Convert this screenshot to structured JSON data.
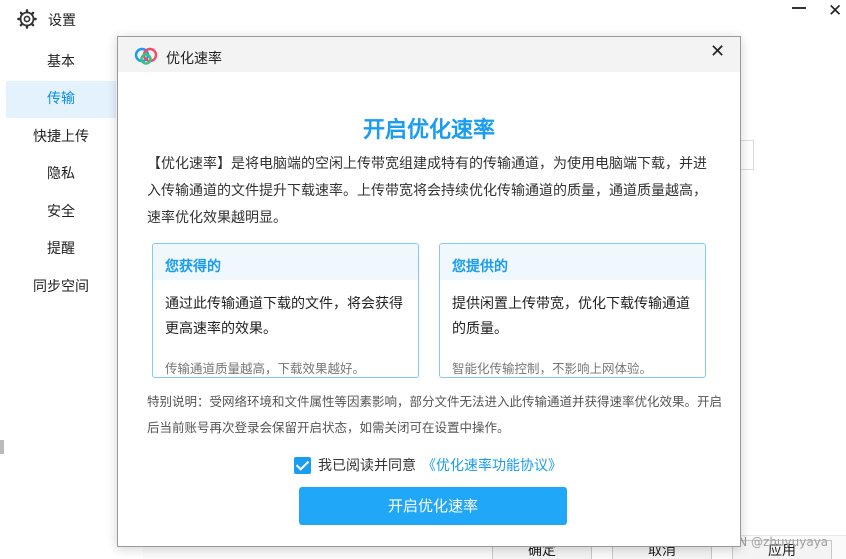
{
  "settings": {
    "title": "设置",
    "gear_icon": "gear-icon",
    "sidebar": {
      "items": [
        {
          "label": "基本",
          "active": false
        },
        {
          "label": "传输",
          "active": true
        },
        {
          "label": "快捷上传",
          "active": false
        },
        {
          "label": "隐私",
          "active": false
        },
        {
          "label": "安全",
          "active": false
        },
        {
          "label": "提醒",
          "active": false
        },
        {
          "label": "同步空间",
          "active": false
        }
      ]
    },
    "footer": {
      "ok_label": "确定",
      "cancel_label": "取消",
      "apply_label": "应用"
    }
  },
  "modal": {
    "title": "优化速率",
    "heading": "开启优化速率",
    "description": "【优化速率】是将电脑端的空闲上传带宽组建成特有的传输通道，为使用电脑端下载，并进入传输通道的文件提升下载速率。上传带宽将会持续优化传输通道的质量，通道质量越高，速率优化效果越明显。",
    "cards": [
      {
        "title": "您获得的",
        "body": "通过此传输通道下载的文件，将会获得更高速率的效果。",
        "foot": "传输通道质量越高，下载效果越好。"
      },
      {
        "title": "您提供的",
        "body": "提供闲置上传带宽，优化下载传输通道的质量。",
        "foot": "智能化传输控制，不影响上网体验。"
      }
    ],
    "note": "特别说明：受网络环境和文件属性等因素影响，部分文件无法进入此传输通道并获得速率优化效果。开启后当前账号再次登录会保留开启状态，如需关闭可在设置中操作。",
    "agree_text": "我已阅读并同意",
    "agree_link": "《优化速率功能协议》",
    "agree_checked": true,
    "enable_button": "开启优化速率",
    "accent_color": "#1a9cf0"
  },
  "watermark": "CSDN @zhuyuyaya"
}
